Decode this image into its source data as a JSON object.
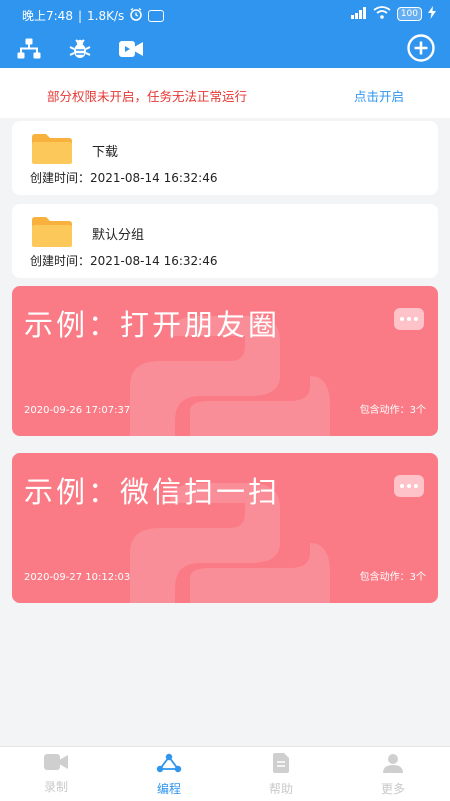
{
  "status_bar": {
    "time": "晚上7:48",
    "speed": "1.8K/s",
    "battery": "100"
  },
  "toolbar": {
    "icons": [
      "flowchart-icon",
      "bug-icon",
      "video-camera-icon",
      "add-circle-icon"
    ]
  },
  "notice": {
    "message": "部分权限未开启，任务无法正常运行",
    "action": "点击开启"
  },
  "folders": [
    {
      "name": "下载",
      "created_label": "创建时间：",
      "created": "2021-08-14 16:32:46"
    },
    {
      "name": "默认分组",
      "created_label": "创建时间：",
      "created": "2021-08-14 16:32:46"
    }
  ],
  "tasks": [
    {
      "title": "示例：打开朋友圈",
      "date": "2020-09-26 17:07:37",
      "actions_label": "包含动作：",
      "actions_count": "3个"
    },
    {
      "title": "示例：微信扫一扫",
      "date": "2020-09-27 10:12:03",
      "actions_label": "包含动作：",
      "actions_count": "3个"
    }
  ],
  "bottom_nav": {
    "items": [
      {
        "label": "录制",
        "icon": "video-camera-icon",
        "active": false
      },
      {
        "label": "编程",
        "icon": "share-nodes-icon",
        "active": true
      },
      {
        "label": "帮助",
        "icon": "document-icon",
        "active": false
      },
      {
        "label": "更多",
        "icon": "person-icon",
        "active": false
      }
    ]
  },
  "colors": {
    "primary": "#2f95ee",
    "task_card": "#fa7b86",
    "notice_text": "#e53935",
    "folder": "#f7b13c"
  }
}
